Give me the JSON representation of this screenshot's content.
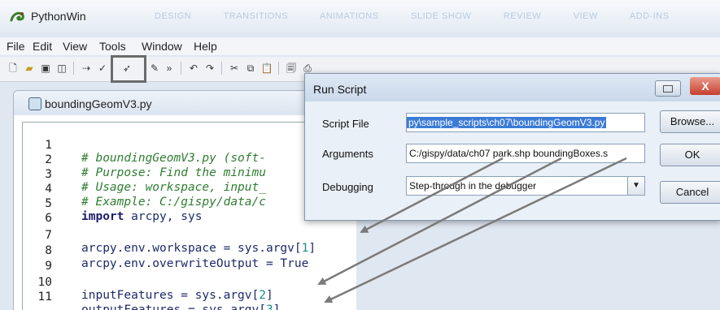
{
  "app": {
    "title": "PythonWin",
    "ribbon_tabs": [
      "DESIGN",
      "TRANSITIONS",
      "ANIMATIONS",
      "SLIDE SHOW",
      "REVIEW",
      "VIEW",
      "ADD-INS"
    ]
  },
  "menu": [
    "File",
    "Edit",
    "View",
    "Tools",
    "Window",
    "Help"
  ],
  "editor": {
    "filename": "boundingGeomV3.py",
    "lines": [
      {
        "n": "1",
        "text": "# boundingGeomV3.py (soft-",
        "kind": "comment"
      },
      {
        "n": "2",
        "text": "# Purpose: Find the minimu",
        "kind": "comment"
      },
      {
        "n": "3",
        "text": "# Usage: workspace, input_",
        "kind": "comment"
      },
      {
        "n": "4",
        "text": "# Example: C:/gispy/data/c",
        "kind": "comment"
      },
      {
        "n": "5",
        "kw": "import",
        "rest": " arcpy, sys",
        "kind": "import"
      },
      {
        "n": "6",
        "text": "",
        "kind": "blank"
      },
      {
        "n": "7",
        "pre": "arcpy.env.workspace = sys.argv[",
        "num": "1",
        "post": "]",
        "kind": "index"
      },
      {
        "n": "8",
        "text": "arcpy.env.overwriteOutput = True",
        "kind": "plain"
      },
      {
        "n": "9",
        "text": "",
        "kind": "blank"
      },
      {
        "n": "10",
        "pre": "inputFeatures = sys.argv[",
        "num": "2",
        "post": "]",
        "kind": "index"
      },
      {
        "n": "11",
        "pre": "outputFeatures = sys.argv[",
        "num": "3",
        "post": "]",
        "kind": "index"
      }
    ]
  },
  "dialog": {
    "title": "Run Script",
    "close_label": "X",
    "script_file_label": "Script File",
    "script_file_value": "py\\sample_scripts\\ch07\\boundingGeomV3.py",
    "arguments_label": "Arguments",
    "arguments_value": "C:/gispy/data/ch07 park.shp boundingBoxes.s",
    "debugging_label": "Debugging",
    "debugging_value": "Step-through in the debugger",
    "browse_label": "Browse...",
    "ok_label": "OK",
    "cancel_label": "Cancel"
  },
  "colors": {
    "comment": "#2f7d32",
    "keyword": "#1d1d6b",
    "number": "#1a8a8a",
    "selection": "#3c7bd6",
    "close_button": "#c6402e"
  }
}
